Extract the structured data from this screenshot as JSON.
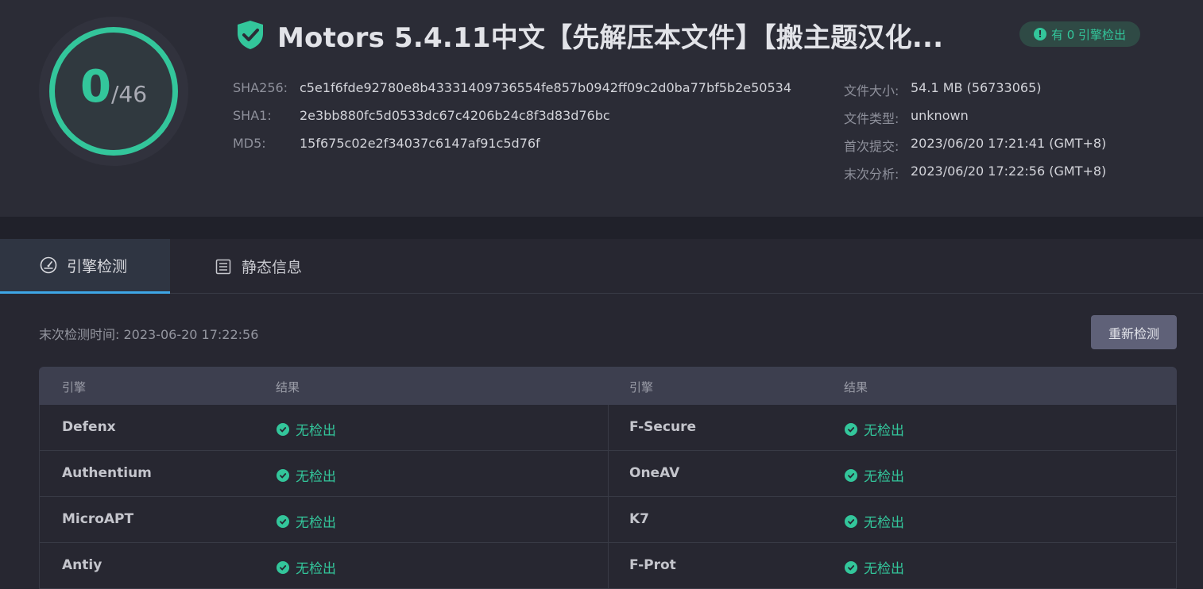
{
  "header": {
    "score": {
      "detected": "0",
      "total": "/46"
    },
    "title": "Motors 5.4.11中文【先解压本文件】【搬主题汉化...",
    "badge": {
      "icon": "!",
      "text": "有 0 引擎检出"
    },
    "hashes": [
      {
        "label": "SHA256:",
        "value": "c5e1f6fde92780e8b43331409736554fe857b0942ff09c2d0ba77bf5b2e50534"
      },
      {
        "label": "SHA1:",
        "value": "2e3bb880fc5d0533dc67c4206b24c8f3d83d76bc"
      },
      {
        "label": "MD5:",
        "value": "15f675c02e2f34037c6147af91c5d76f"
      }
    ],
    "meta": [
      {
        "label": "文件大小:",
        "value": "54.1 MB (56733065)"
      },
      {
        "label": "文件类型:",
        "value": "unknown"
      },
      {
        "label": "首次提交:",
        "value": "2023/06/20 17:21:41 (GMT+8)"
      },
      {
        "label": "末次分析:",
        "value": "2023/06/20 17:22:56 (GMT+8)"
      }
    ]
  },
  "tabs": [
    {
      "label": "引擎检测",
      "icon": "speedometer-icon",
      "active": true
    },
    {
      "label": "静态信息",
      "icon": "list-icon",
      "active": false
    }
  ],
  "scan": {
    "last_scan": "末次检测时间: 2023-06-20 17:22:56",
    "rescan_label": "重新检测"
  },
  "table": {
    "headers": [
      "引擎",
      "结果",
      "引擎",
      "结果"
    ],
    "rows": [
      {
        "left_engine": "Defenx",
        "left_result": "无检出",
        "right_engine": "F-Secure",
        "right_result": "无检出"
      },
      {
        "left_engine": "Authentium",
        "left_result": "无检出",
        "right_engine": "OneAV",
        "right_result": "无检出"
      },
      {
        "left_engine": "MicroAPT",
        "left_result": "无检出",
        "right_engine": "K7",
        "right_result": "无检出"
      },
      {
        "left_engine": "Antiy",
        "left_result": "无检出",
        "right_engine": "F-Prot",
        "right_result": "无检出"
      }
    ]
  },
  "colors": {
    "accent_green": "#33c69b",
    "tab_underline": "#3ea6e6",
    "background": "#272731"
  }
}
